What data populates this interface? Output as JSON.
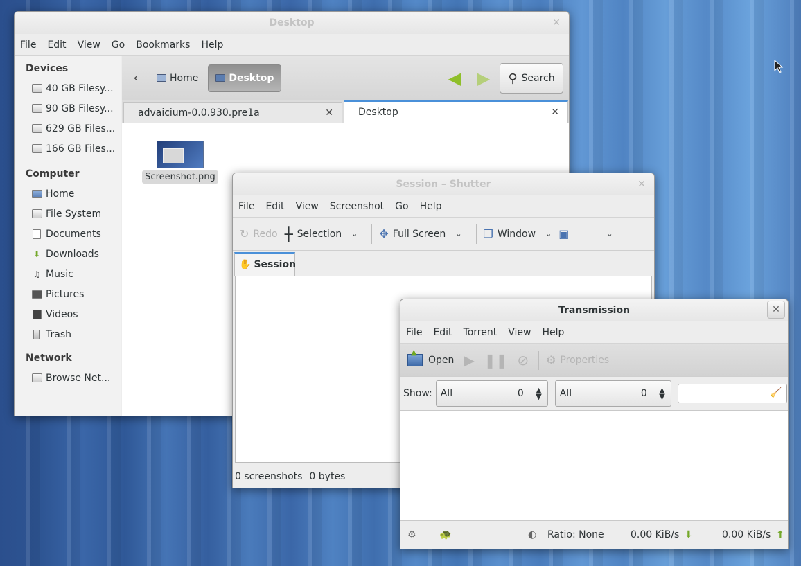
{
  "desktop": {
    "accent_color": "#3a66a8"
  },
  "nautilus": {
    "title": "Desktop",
    "close_glyph": "✕",
    "menu": [
      "File",
      "Edit",
      "View",
      "Go",
      "Bookmarks",
      "Help"
    ],
    "sidebar": {
      "devices_header": "Devices",
      "devices": [
        "40 GB Filesy...",
        "90 GB Filesy...",
        "629 GB Files...",
        "166 GB Files..."
      ],
      "computer_header": "Computer",
      "computer": [
        {
          "label": "Home",
          "icon": "home-icon"
        },
        {
          "label": "File System",
          "icon": "drive-icon"
        },
        {
          "label": "Documents",
          "icon": "documents-icon"
        },
        {
          "label": "Downloads",
          "icon": "downloads-icon"
        },
        {
          "label": "Music",
          "icon": "music-icon"
        },
        {
          "label": "Pictures",
          "icon": "pictures-icon"
        },
        {
          "label": "Videos",
          "icon": "videos-icon"
        },
        {
          "label": "Trash",
          "icon": "trash-icon"
        }
      ],
      "network_header": "Network",
      "network": [
        "Browse Net..."
      ]
    },
    "pathbar": {
      "back": "‹",
      "home": "Home",
      "current": "Desktop",
      "search": "Search"
    },
    "tabs": [
      {
        "label": "advaicium-0.0.930.pre1a",
        "close": "✕"
      },
      {
        "label": "Desktop",
        "close": "✕"
      }
    ],
    "files": [
      {
        "name": "Screenshot.png"
      }
    ]
  },
  "shutter": {
    "title": "Session – Shutter",
    "close_glyph": "✕",
    "menu": [
      "File",
      "Edit",
      "View",
      "Screenshot",
      "Go",
      "Help"
    ],
    "toolbar": {
      "redo": "Redo",
      "selection": "Selection",
      "fullscreen": "Full Screen",
      "window": "Window",
      "dropdown": "⌄"
    },
    "tab": "Session",
    "status": {
      "screenshots": "0 screenshots",
      "bytes": "0 bytes"
    }
  },
  "transmission": {
    "title": "Transmission",
    "close_glyph": "✕",
    "menu": [
      "File",
      "Edit",
      "Torrent",
      "View",
      "Help"
    ],
    "toolbar": {
      "open": "Open",
      "properties": "Properties"
    },
    "filter": {
      "show_label": "Show:",
      "combo1": {
        "value": "All",
        "count": "0"
      },
      "combo2": {
        "value": "All",
        "count": "0"
      },
      "search_value": ""
    },
    "status": {
      "ratio": "Ratio: None",
      "down": "0.00 KiB/s",
      "up": "0.00 KiB/s"
    }
  }
}
